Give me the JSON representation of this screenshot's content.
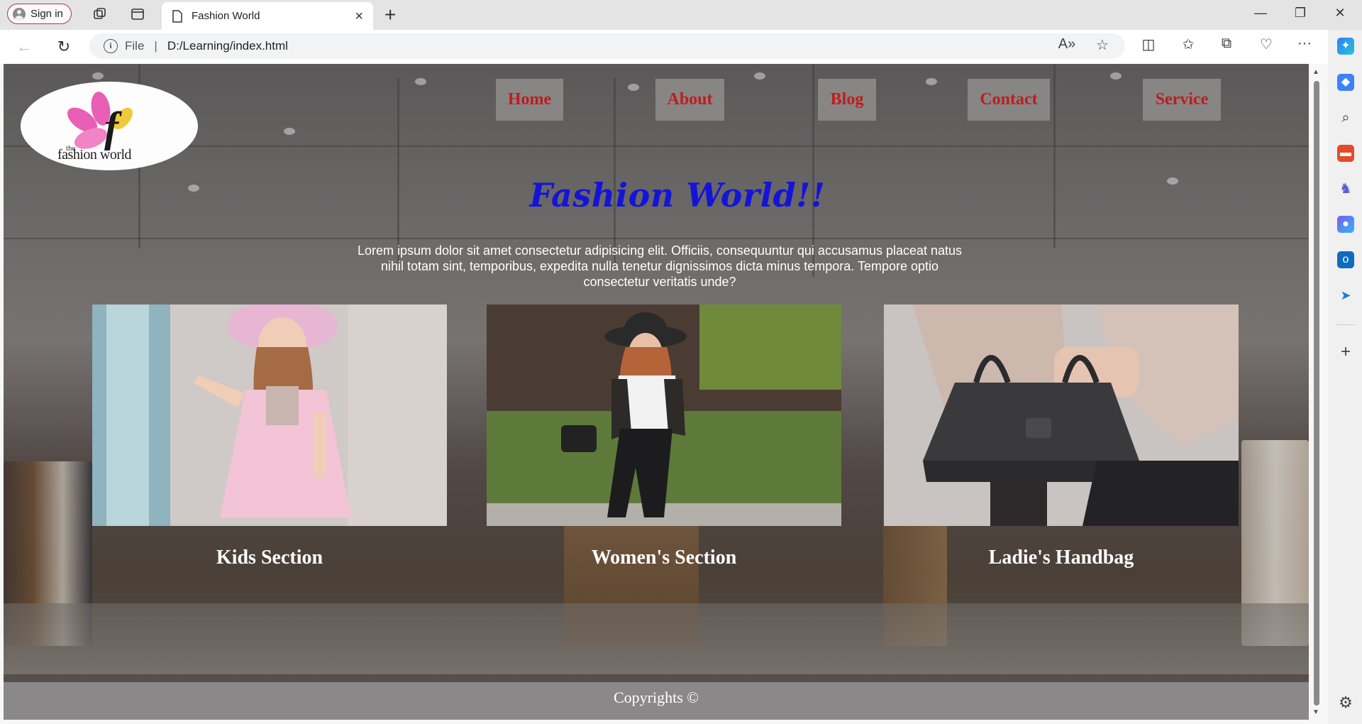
{
  "browser": {
    "signin_label": "Sign in",
    "tab_title": "Fashion World",
    "address_protocol": "File",
    "address_url": "D:/Learning/index.html"
  },
  "page": {
    "logo": {
      "small": "the",
      "name": "fashion world",
      "initial": "f"
    },
    "nav": [
      "Home",
      "About",
      "Blog",
      "Contact",
      "Service"
    ],
    "title": "Fashion World!!",
    "intro": "Lorem ipsum dolor sit amet consectetur adipisicing elit. Officiis,  consequuntur qui accusamus  placeat natus nihil totam sint,  temporibus, expedita nulla tenetur dignissimos dicta minus tempora. Tempore optio consectetur veritatis unde?",
    "cards": [
      {
        "caption": "Kids Section",
        "image": "girl-in-pink-dress-photo"
      },
      {
        "caption": "Women's Section",
        "image": "woman-in-hat-outdoor-photo"
      },
      {
        "caption": "Ladie's Handbag",
        "image": "black-handbag-photo"
      }
    ],
    "footer": "Copyrights ©"
  },
  "colors": {
    "nav_text": "#c01c1c",
    "nav_bg": "#888585",
    "title": "#1414d8",
    "footer_bg": "#8a8888"
  }
}
